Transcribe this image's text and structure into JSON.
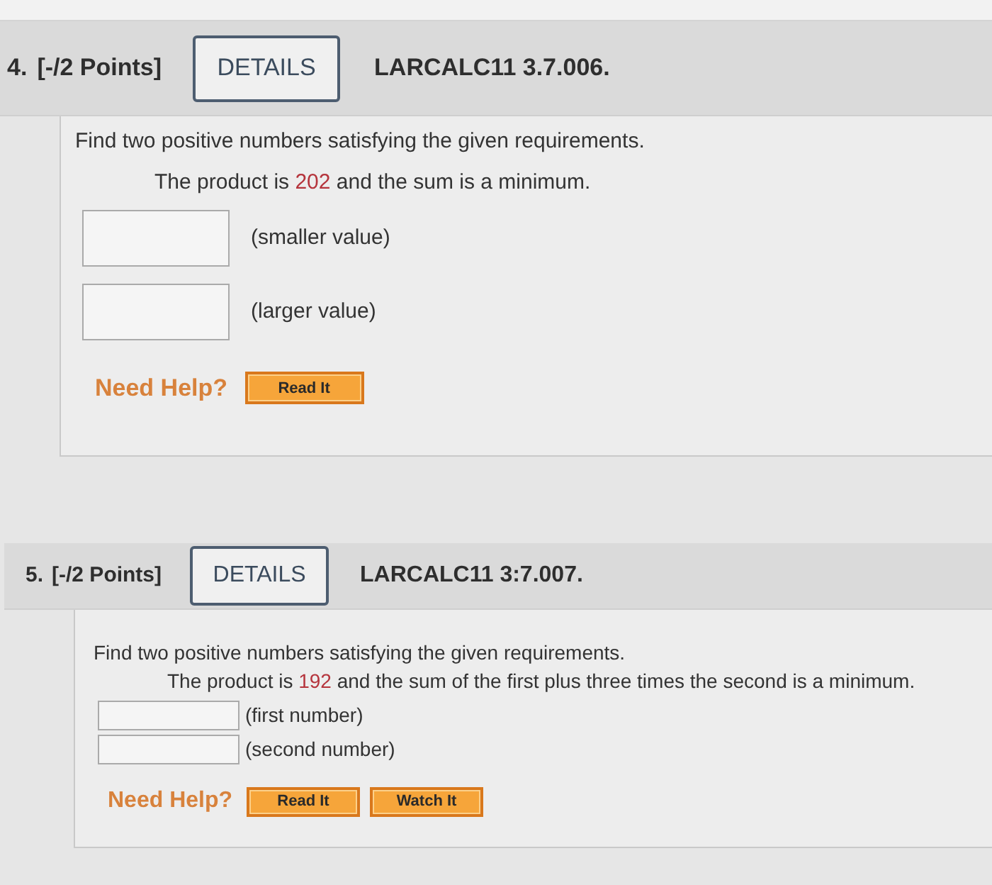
{
  "questions": [
    {
      "kind": "spaced",
      "number": "4.",
      "points": "[-/2 Points]",
      "details_button": "DETAILS",
      "code": "LARCALC11 3.7.006.",
      "prompt": "Find two positive numbers satisfying the given requirements.",
      "requirement": [
        {
          "kind": "plain",
          "text": "The product is "
        },
        {
          "kind": "given",
          "text": "202"
        },
        {
          "kind": "plain",
          "text": " and the sum is a minimum."
        }
      ],
      "answers": [
        {
          "label": "(smaller value)"
        },
        {
          "label": "(larger value)"
        }
      ],
      "help": {
        "label": "Need Help?",
        "buttons": [
          "Read It"
        ]
      }
    },
    {
      "kind": "compact",
      "number": "5.",
      "points": "[-/2 Points]",
      "details_button": "DETAILS",
      "code": "LARCALC11 3:7.007.",
      "prompt": "Find two positive numbers satisfying the given requirements.",
      "requirement": [
        {
          "kind": "plain",
          "text": "The product is "
        },
        {
          "kind": "given",
          "text": "192"
        },
        {
          "kind": "plain",
          "text": " and the sum of the first plus three times the second is a minimum."
        }
      ],
      "answers": [
        {
          "label": "(first number)"
        },
        {
          "label": "(second number)"
        }
      ],
      "help": {
        "label": "Need Help?",
        "buttons": [
          "Read It",
          "Watch It"
        ]
      }
    }
  ]
}
